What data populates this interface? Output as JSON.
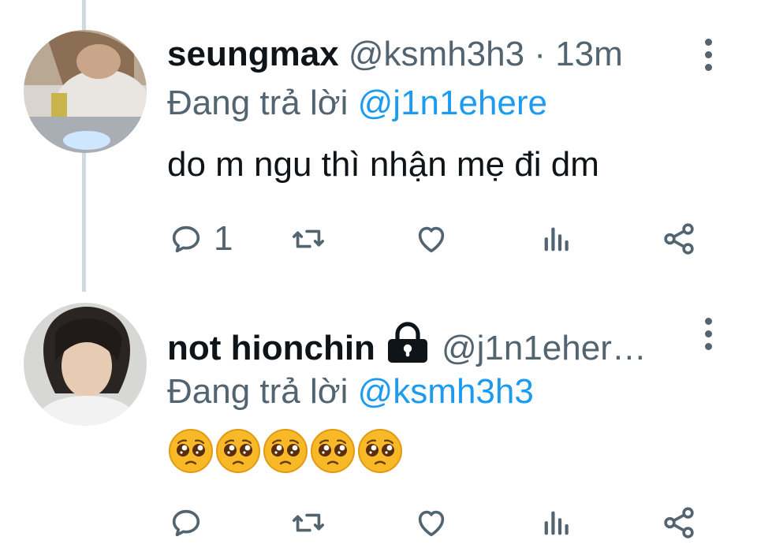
{
  "tweets": [
    {
      "display_name": "seungmax",
      "handle": "@ksmh3h3",
      "separator": "·",
      "time": "13m",
      "reply_prefix": "Đang trả lời",
      "reply_to": "@j1n1ehere",
      "text": "do m ngu thì nhận mẹ đi dm",
      "reply_count": "1"
    },
    {
      "display_name": "not hionchin",
      "handle": "@j1n1eher…",
      "reply_prefix": "Đang trả lời",
      "reply_to": "@ksmh3h3",
      "emojis": [
        "pleading-face",
        "pleading-face",
        "pleading-face",
        "pleading-face",
        "pleading-face"
      ]
    }
  ],
  "icons": {
    "reply": "reply-icon",
    "retweet": "retweet-icon",
    "like": "heart-icon",
    "views": "analytics-icon",
    "share": "share-icon",
    "more": "more-vertical-icon",
    "lock": "lock-icon"
  },
  "colors": {
    "link": "#1d9bf0",
    "secondary_text": "#536471",
    "primary_text": "#0f1419",
    "thread_line": "#cfd9de"
  }
}
